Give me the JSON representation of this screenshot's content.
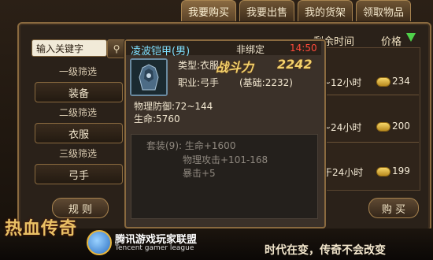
{
  "tabs": [
    {
      "label": "我要购买",
      "active": true
    },
    {
      "label": "我要出售",
      "active": false
    },
    {
      "label": "我的货架",
      "active": false
    },
    {
      "label": "领取物品",
      "active": false
    }
  ],
  "search": {
    "placeholder": "输入关键字"
  },
  "filters": {
    "level1_label": "一级筛选",
    "level1_value": "装备",
    "level2_label": "二级筛选",
    "level2_value": "衣服",
    "level3_label": "三级筛选",
    "level3_value": "弓手"
  },
  "columns": {
    "remaining_time": "剩余时间",
    "price": "价格"
  },
  "listings": [
    {
      "time": "~12小时",
      "price": "234"
    },
    {
      "time": "~24小时",
      "price": "200"
    },
    {
      "time": "于24小时",
      "price": "199"
    }
  ],
  "buttons": {
    "rules": "规 则",
    "buy": "购 买"
  },
  "tooltip": {
    "item_name": "凌波铠甲(男)",
    "bind_status": "非绑定",
    "counter": "14:50",
    "type_line": "类型:衣服",
    "class_line": "职业:弓手",
    "power_label": "战斗力",
    "power_value": "2242",
    "power_base": "(基础:2232)",
    "phys_def": "物理防御:72~144",
    "hp": "生命:5760",
    "set_lines": [
      "套装(9): 生命+1600",
      "物理攻击+101-168",
      "暴击+5"
    ]
  },
  "footer": {
    "game_logo": "热血传奇",
    "league_cn": "腾讯游戏玩家联盟",
    "league_en": "Tencent gamer league",
    "slogan": "时代在变，传奇不会改变"
  },
  "colors": {
    "gold": "#f3d16b",
    "item_name": "#7fe0ff",
    "counter": "#ff4a3a",
    "set_text": "#8f887f"
  }
}
